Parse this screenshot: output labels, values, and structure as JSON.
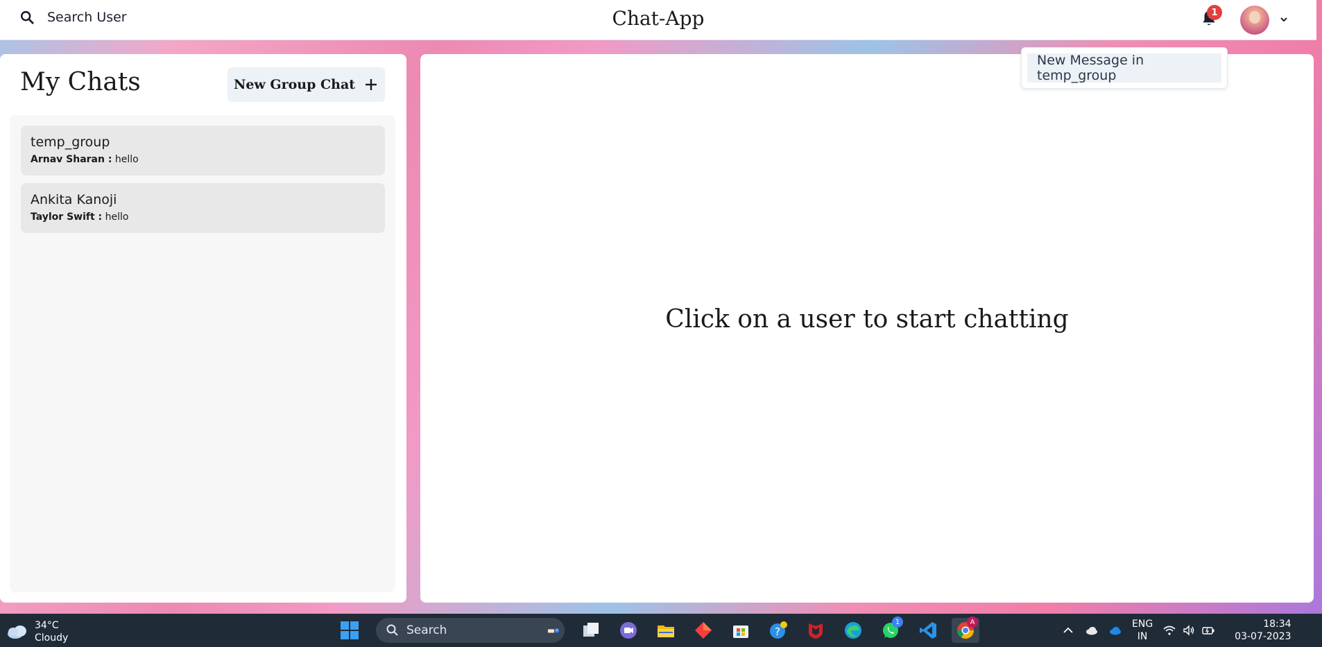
{
  "header": {
    "search_label": "Search User",
    "app_title": "Chat-App",
    "notification_count": "1"
  },
  "notifications": {
    "items": [
      {
        "label": "New Message in temp_group"
      }
    ]
  },
  "sidebar": {
    "title": "My Chats",
    "new_group_label": "New Group Chat",
    "chats": [
      {
        "name": "temp_group",
        "sender": "Arnav Sharan :",
        "message": "hello"
      },
      {
        "name": "Ankita Kanoji",
        "sender": "Taylor Swift :",
        "message": "hello"
      }
    ]
  },
  "main": {
    "empty_message": "Click on a user to start chatting"
  },
  "taskbar": {
    "weather_temp": "34°C",
    "weather_desc": "Cloudy",
    "search_label": "Search",
    "whatsapp_badge": "1",
    "chrome_badge": "A",
    "lang_top": "ENG",
    "lang_bottom": "IN",
    "time": "18:34",
    "date": "03-07-2023"
  },
  "colors": {
    "accent_badge": "#e53e3e",
    "button_bg": "#edf2f7",
    "taskbar_bg": "#202b38"
  }
}
